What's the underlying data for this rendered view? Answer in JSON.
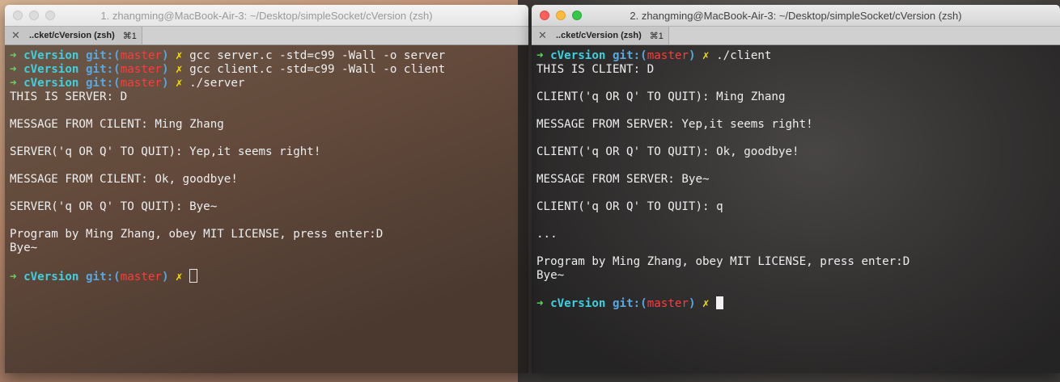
{
  "left": {
    "title": "1. zhangming@MacBook-Air-3: ~/Desktop/simpleSocket/cVersion (zsh)",
    "tab": {
      "close": "✕",
      "label": "..cket/cVersion (zsh)",
      "shortcut": "⌘1"
    },
    "prompt": {
      "arrow": "➜",
      "dir": "cVersion",
      "git_open": "git:(",
      "branch": "master",
      "git_close": ")",
      "dirty": "✗"
    },
    "commands": [
      "gcc server.c -std=c99 -Wall -o server",
      "gcc client.c -std=c99 -Wall -o client",
      "./server"
    ],
    "output": [
      "THIS IS SERVER: D",
      "",
      "MESSAGE FROM CILENT: Ming Zhang",
      "",
      "SERVER('q OR Q' TO QUIT): Yep,it seems right!",
      "",
      "MESSAGE FROM CILENT: Ok, goodbye!",
      "",
      "SERVER('q OR Q' TO QUIT): Bye~",
      "",
      "Program by Ming Zhang, obey MIT LICENSE, press enter:D",
      "Bye~",
      ""
    ]
  },
  "right": {
    "title": "2. zhangming@MacBook-Air-3: ~/Desktop/simpleSocket/cVersion (zsh)",
    "tab": {
      "close": "✕",
      "label": "..cket/cVersion (zsh)",
      "shortcut": "⌘1"
    },
    "prompt": {
      "arrow": "➜",
      "dir": "cVersion",
      "git_open": "git:(",
      "branch": "master",
      "git_close": ")",
      "dirty": "✗"
    },
    "commands": [
      "./client"
    ],
    "output": [
      "THIS IS CLIENT: D",
      "",
      "CLIENT('q OR Q' TO QUIT): Ming Zhang",
      "",
      "MESSAGE FROM SERVER: Yep,it seems right!",
      "",
      "CLIENT('q OR Q' TO QUIT): Ok, goodbye!",
      "",
      "MESSAGE FROM SERVER: Bye~",
      "",
      "CLIENT('q OR Q' TO QUIT): q",
      "",
      "...",
      "",
      "Program by Ming Zhang, obey MIT LICENSE, press enter:D",
      "Bye~",
      ""
    ]
  }
}
